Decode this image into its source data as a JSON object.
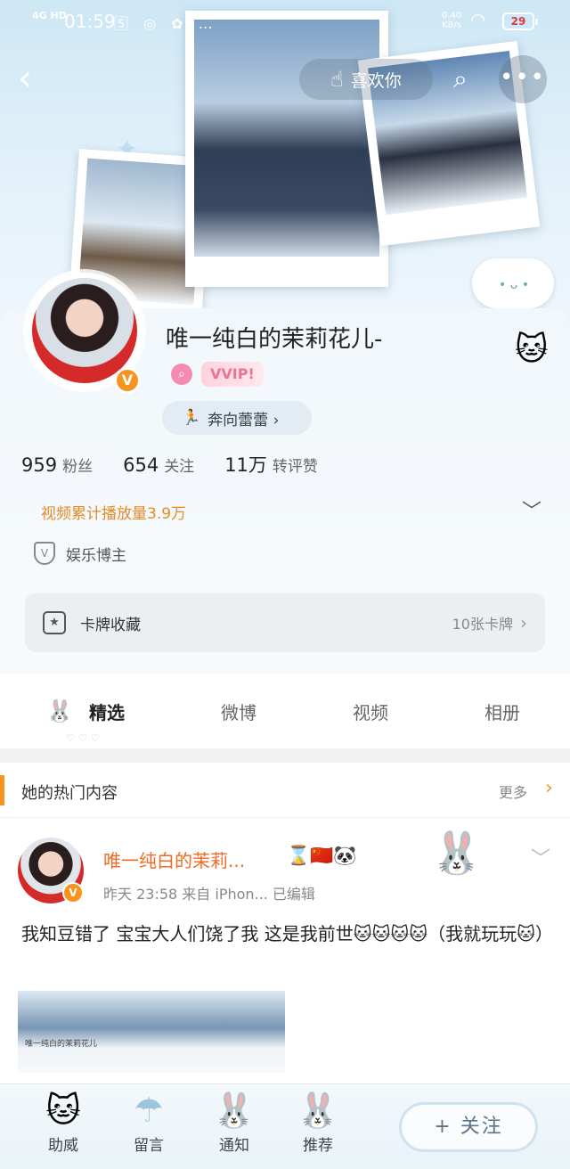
{
  "status_bar": {
    "network": "4G HD",
    "time": "01:59",
    "icons": "🅂 ◎ ✿ …",
    "speed": "0.40\nKB/s",
    "battery": "29"
  },
  "nav": {
    "back": "‹",
    "like_label": "喜欢你",
    "search": "⌕",
    "more": "•••"
  },
  "profile": {
    "username": "唯一纯白的茉莉花儿-",
    "vvip_badge": "VVIP!",
    "tag_label": "奔向蕾蕾 ›",
    "stats": [
      {
        "num": "959",
        "label": "粉丝"
      },
      {
        "num": "654",
        "label": "关注"
      },
      {
        "num": "11万",
        "label": "转评赞"
      }
    ],
    "video_plays": "视频累计播放量3.9万",
    "category": "娱乐博主",
    "card_collection": {
      "label": "卡牌收藏",
      "count": "10张卡牌"
    }
  },
  "tabs": [
    "精选",
    "微博",
    "视频",
    "相册"
  ],
  "hot": {
    "title": "她的热门内容",
    "more": "更多"
  },
  "post": {
    "name": "唯一纯白的茉莉...",
    "emojis": "⌛🇨🇳🐼",
    "meta": "昨天 23:58   来自 iPhon...   已编辑",
    "text": "我知豆错了 宝宝大人们饶了我 这是我前世🐱🐱🐱🐱（我就玩玩🐱）",
    "thumb_caption": "唯一纯白的茉莉花儿"
  },
  "bottom_bar": {
    "items": [
      {
        "label": "助威",
        "icon": "🐱"
      },
      {
        "label": "留言",
        "icon": "☂"
      },
      {
        "label": "通知",
        "icon": "🐰"
      },
      {
        "label": "推荐",
        "icon": "🐰"
      }
    ],
    "follow": "+ 关注"
  },
  "colors": {
    "accent": "#f7931e",
    "name_orange": "#f26a21"
  }
}
